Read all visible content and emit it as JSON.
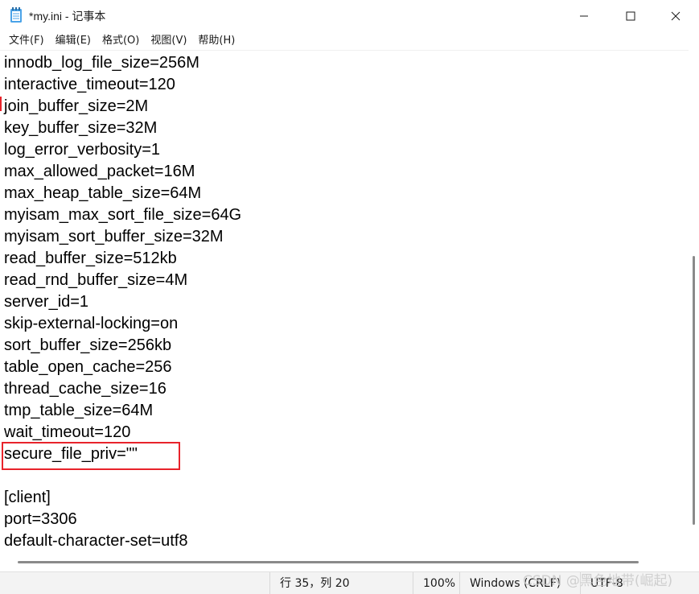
{
  "window": {
    "title": "*my.ini - 记事本",
    "icon": "notepad-icon",
    "controls": {
      "minimize": "minimize-icon",
      "maximize": "maximize-icon",
      "close": "close-icon"
    }
  },
  "menu": {
    "items": [
      "文件(F)",
      "编辑(E)",
      "格式(O)",
      "视图(V)",
      "帮助(H)"
    ]
  },
  "editor": {
    "lines": [
      "innodb_log_file_size=256M",
      "interactive_timeout=120",
      "join_buffer_size=2M",
      "key_buffer_size=32M",
      "log_error_verbosity=1",
      "max_allowed_packet=16M",
      "max_heap_table_size=64M",
      "myisam_max_sort_file_size=64G",
      "myisam_sort_buffer_size=32M",
      "read_buffer_size=512kb",
      "read_rnd_buffer_size=4M",
      "server_id=1",
      "skip-external-locking=on",
      "sort_buffer_size=256kb",
      "table_open_cache=256",
      "thread_cache_size=16",
      "tmp_table_size=64M",
      "wait_timeout=120",
      "secure_file_priv=\"\"",
      "",
      "[client]",
      "port=3306",
      "default-character-set=utf8"
    ],
    "highlight_color": "#e8232b"
  },
  "status": {
    "position": "行 35，列 20",
    "zoom": "100%",
    "line_ending": "Windows (CRLF)",
    "encoding": "UTF-8"
  },
  "watermark": "CSDN @黑色地带(崛起)"
}
